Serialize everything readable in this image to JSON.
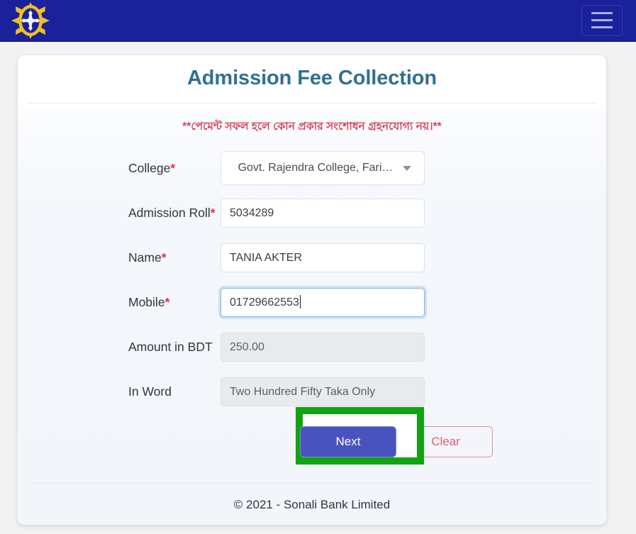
{
  "navbar": {
    "logo_icon": "sonali-bank-sun-logo",
    "menu_icon": "hamburger-menu-icon",
    "menu_label": "Toggle navigation",
    "background_color": "#1a219b"
  },
  "card": {
    "title": "Admission Fee Collection",
    "title_color": "#31708f",
    "notice": "**পেমেন্ট সফল হলে কোন প্রকার সংশোধন গ্রহনযোগ্য নয়।**",
    "notice_color": "#d6415a"
  },
  "form": {
    "fields": [
      {
        "label": "College",
        "required": true,
        "required_mark": "*",
        "type": "select",
        "value": "Govt. Rajendra College, Fari…",
        "state": "enabled",
        "caret_icon": "chevron-down-icon"
      },
      {
        "label": "Admission Roll",
        "required": true,
        "required_mark": "*",
        "type": "text",
        "value": "5034289",
        "state": "enabled"
      },
      {
        "label": "Name",
        "required": true,
        "required_mark": "*",
        "type": "text",
        "value": "TANIA AKTER",
        "state": "enabled"
      },
      {
        "label": "Mobile",
        "required": true,
        "required_mark": "*",
        "type": "text",
        "value": "01729662553",
        "state": "focused"
      },
      {
        "label": "Amount in BDT",
        "required": false,
        "required_mark": "",
        "type": "text",
        "value": "250.00",
        "state": "disabled"
      },
      {
        "label": "In Word",
        "required": false,
        "required_mark": "",
        "type": "text",
        "value": "Two Hundred Fifty Taka  Only",
        "state": "disabled"
      }
    ]
  },
  "actions": {
    "next_label": "Next",
    "next_color": "#4a53bd",
    "clear_label": "Clear",
    "clear_color": "#e06070",
    "highlight_color": "#12a312",
    "highlight_target": "Next"
  },
  "footer": {
    "copyright": "© 2021 - Sonali Bank Limited"
  }
}
